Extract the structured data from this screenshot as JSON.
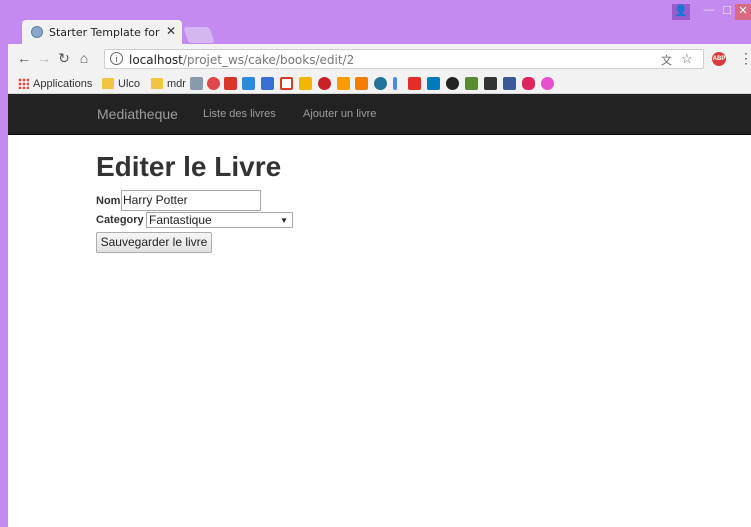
{
  "browser": {
    "tab_title": "Starter Template for Boo",
    "url_host": "localhost",
    "url_path": "/projet_ws/cake/books/edit/2"
  },
  "bookmarks": {
    "apps_label": "Applications",
    "items": [
      "Ulco",
      "mdr"
    ],
    "icons": [
      "pocket-icon",
      "red-icon",
      "flow-icon",
      "calendar-icon",
      "gmail-icon",
      "drive-icon",
      "pinterest-icon",
      "amazon-icon",
      "blogger-icon",
      "wordpress-icon",
      "dots-icon",
      "youtube-icon",
      "trello-icon",
      "github-icon",
      "minecraft-icon",
      "binoculars-icon",
      "facebook-icon",
      "heart-icon",
      "pink-icon"
    ]
  },
  "site": {
    "brand": "Mediatheque",
    "nav_links": [
      "Liste des livres",
      "Ajouter un livre"
    ]
  },
  "form": {
    "heading": "Editer le Livre",
    "name_label": "Nom",
    "name_value": "Harry Potter",
    "category_label": "Category",
    "category_value": "Fantastique",
    "submit_label": "Sauvegarder le livre"
  },
  "colors": {
    "frame": "#c58af0",
    "navbar": "#222222",
    "nav_text": "#9d9d9d"
  }
}
